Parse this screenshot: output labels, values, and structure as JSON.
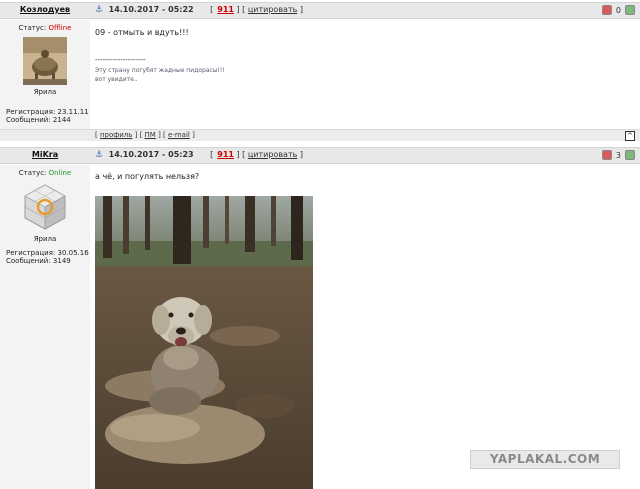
{
  "posts": [
    {
      "author": "Козлодуев",
      "date": "14.10.2017 - 05:22",
      "number": "911",
      "cite_label": "цитировать",
      "rating": "0",
      "status_label": "Статус:",
      "status": "Offline",
      "rank": "Ярила",
      "reg_line": "Регистрация: 23.11.11",
      "msg_line": "Сообщений: 2144",
      "message": "09 - отмыть и вдуть!!!",
      "sig_separator": "--------------------",
      "signature_lines": [
        "Эту страну погубят жадные пидорасы!!!",
        "вот увидите.."
      ],
      "footer_links": [
        "профиль",
        "ПМ",
        "e-mail"
      ],
      "up_label": "^"
    },
    {
      "author": "MiKra",
      "date": "14.10.2017 - 05:23",
      "number": "911",
      "cite_label": "цитировать",
      "rating": "3",
      "status_label": "Статус:",
      "status": "Online",
      "rank": "Ярила",
      "reg_line": "Регистрация: 30.05.16",
      "msg_line": "Сообщений: 3149",
      "message": "а чё, и погулять нельзя?"
    }
  ],
  "watermark": "YAPLAKAL.COM",
  "colors": {
    "offline": "#cc0000",
    "online": "#2a9a2a",
    "post_number": "#cc0000"
  }
}
